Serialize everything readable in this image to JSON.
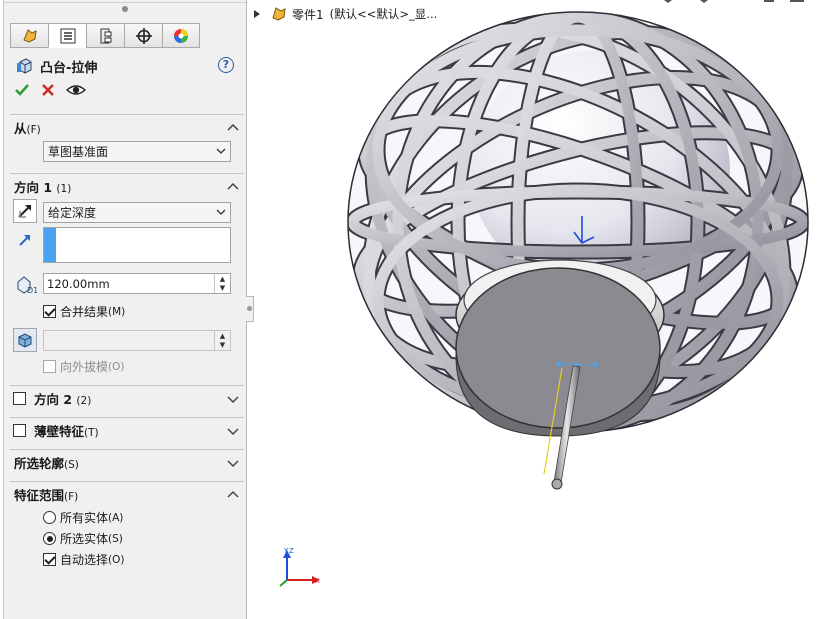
{
  "feature": {
    "title": "凸台-拉伸"
  },
  "tabs": [
    {
      "name": "feature-manager"
    },
    {
      "name": "property-manager"
    },
    {
      "name": "configuration-manager"
    },
    {
      "name": "dimxpert-manager"
    },
    {
      "name": "display-manager"
    }
  ],
  "from_section": {
    "title": "从",
    "key": "(F)",
    "value": "草图基准面"
  },
  "direction1": {
    "title": "方向 1",
    "key": "(1)",
    "end_condition": "给定深度",
    "depth": "120.00mm",
    "merge_result": {
      "label": "合并结果",
      "key": "(M)",
      "checked": true
    },
    "draft": {
      "label": "向外拔模",
      "key": "(O)",
      "checked": false,
      "disabled": true
    }
  },
  "direction2": {
    "title": "方向 2",
    "key": "(2)",
    "checked": false
  },
  "thin_feature": {
    "title": "薄壁特征",
    "key": "(T)",
    "checked": false
  },
  "selected_contours": {
    "title": "所选轮廓",
    "key": "(S)"
  },
  "feature_scope": {
    "title": "特征范围",
    "key": "(F)",
    "options": [
      {
        "label": "所有实体",
        "key": "(A)",
        "selected": false
      },
      {
        "label": "所选实体",
        "key": "(S)",
        "selected": true
      }
    ],
    "auto_select": {
      "label": "自动选择",
      "key": "(O)",
      "checked": true
    }
  },
  "tree": {
    "part_label": "零件1",
    "config_label": "(默认<<默认>_显..."
  },
  "colors": {
    "accept": "#2e9b2e",
    "cancel": "#c8281e",
    "accent": "#2b5ea8",
    "selection_blue": "#4aa3f0"
  },
  "triad": {
    "x": "X",
    "y": "Y",
    "z": "Z"
  }
}
